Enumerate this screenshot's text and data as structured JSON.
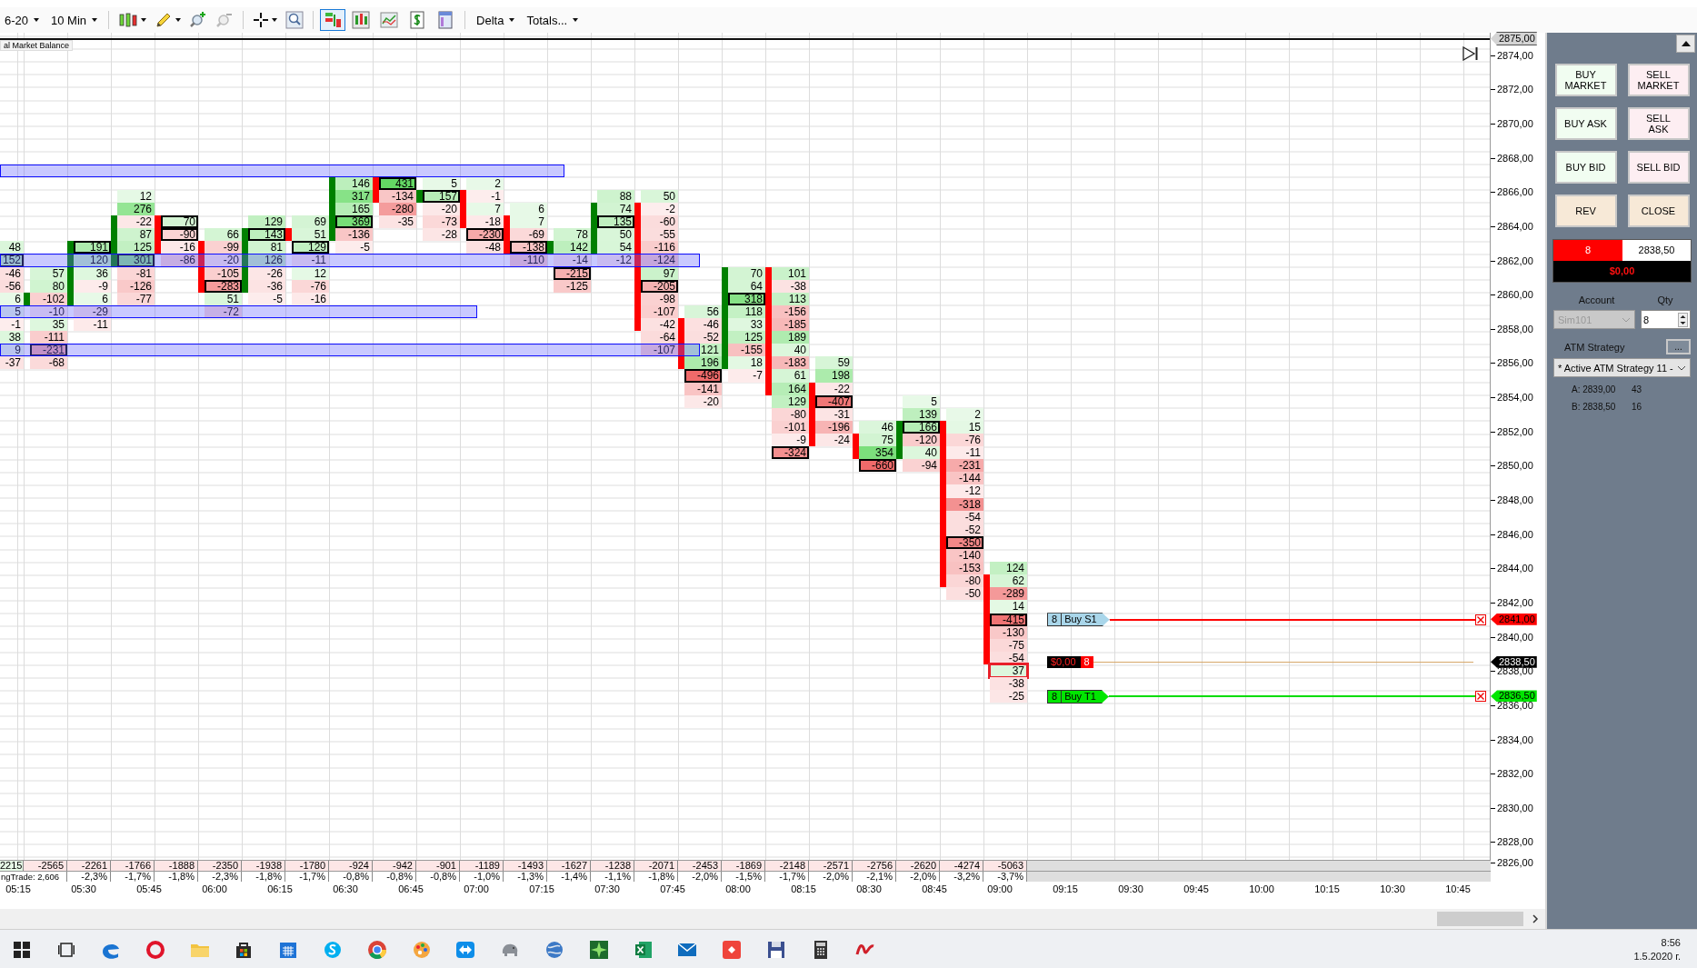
{
  "toolbar": {
    "instrument": "6-20",
    "interval": "10 Min",
    "views": [
      {
        "selected": true
      },
      {
        "selected": false
      },
      {
        "selected": false
      },
      {
        "selected": false
      },
      {
        "selected": false
      }
    ],
    "mode": "Delta",
    "totals": "Totals..."
  },
  "chart": {
    "indicator_label": "al Market Balance",
    "top_price": "2875,00",
    "axis_labels": [
      "2874,00",
      "2872,00",
      "2870,00",
      "2868,00",
      "2866,00",
      "2864,00",
      "2862,00",
      "2860,00",
      "2858,00",
      "2856,00",
      "2854,00",
      "2852,00",
      "2850,00",
      "2848,00",
      "2846,00",
      "2844,00",
      "2842,00",
      "2840,00",
      "2838,00",
      "2836,00",
      "2834,00",
      "2832,00",
      "2830,00",
      "2828,00",
      "2826,00"
    ],
    "footprint": {
      "bars": [
        {
          "cells": [
            null,
            null,
            null,
            null,
            null,
            {
              "value": "48",
              "outlined": false,
              "candle": false,
              "current": false
            },
            {
              "value": "152",
              "outlined": true,
              "candle": false,
              "current": false
            },
            {
              "value": "-46",
              "outlined": false,
              "candle": false,
              "current": false
            },
            {
              "value": "-56",
              "outlined": false,
              "candle": false,
              "current": false
            },
            {
              "value": "6",
              "outlined": false,
              "candle": false,
              "current": false
            },
            {
              "value": "5",
              "outlined": false,
              "candle": false,
              "current": false
            },
            {
              "value": "-1",
              "outlined": false,
              "candle": false,
              "current": false
            },
            {
              "value": "38",
              "outlined": false,
              "candle": false,
              "current": false
            },
            {
              "value": "9",
              "outlined": false,
              "candle": false,
              "current": false
            },
            {
              "value": "-37",
              "outlined": false,
              "candle": false,
              "current": false
            }
          ]
        },
        {
          "color": "#008000",
          "cells": [
            null,
            null,
            null,
            null,
            null,
            null,
            null,
            {
              "value": "57",
              "outlined": false,
              "candle": false,
              "current": false
            },
            {
              "value": "80",
              "outlined": false,
              "candle": false,
              "current": false
            },
            {
              "value": "-102",
              "outlined": false,
              "candle": true,
              "current": false
            },
            {
              "value": "-10",
              "outlined": false,
              "candle": false,
              "current": false
            },
            {
              "value": "35",
              "outlined": false,
              "candle": false,
              "current": false
            },
            {
              "value": "-111",
              "outlined": false,
              "candle": false,
              "current": false
            },
            {
              "value": "-231",
              "outlined": true,
              "candle": false,
              "current": false
            },
            {
              "value": "-68",
              "outlined": false,
              "candle": false,
              "current": false
            }
          ]
        },
        {
          "color": "#008000",
          "cells": [
            null,
            null,
            null,
            null,
            null,
            {
              "value": "191",
              "outlined": true,
              "candle": true,
              "current": false
            },
            {
              "value": "120",
              "outlined": false,
              "candle": true,
              "current": false
            },
            {
              "value": "36",
              "outlined": false,
              "candle": true,
              "current": false
            },
            {
              "value": "-9",
              "outlined": false,
              "candle": true,
              "current": false
            },
            {
              "value": "6",
              "outlined": false,
              "candle": true,
              "current": false
            },
            {
              "value": "-29",
              "outlined": false,
              "candle": false,
              "current": false
            },
            {
              "value": "-11",
              "outlined": false,
              "candle": false,
              "current": false
            }
          ]
        },
        {
          "color": "#008000",
          "cells": [
            null,
            {
              "value": "12",
              "outlined": false,
              "candle": false,
              "current": false
            },
            {
              "value": "276",
              "outlined": false,
              "candle": false,
              "current": false
            },
            {
              "value": "-22",
              "outlined": false,
              "candle": true,
              "current": false
            },
            {
              "value": "87",
              "outlined": false,
              "candle": true,
              "current": false
            },
            {
              "value": "125",
              "outlined": false,
              "candle": true,
              "current": false
            },
            {
              "value": "301",
              "outlined": true,
              "candle": true,
              "current": false
            },
            {
              "value": "-81",
              "outlined": false,
              "candle": false,
              "current": false
            },
            {
              "value": "-126",
              "outlined": false,
              "candle": false,
              "current": false
            },
            {
              "value": "-77",
              "outlined": false,
              "candle": false,
              "current": false
            }
          ]
        },
        {
          "color": "#ff0000",
          "cells": [
            null,
            null,
            null,
            {
              "value": "70",
              "outlined": true,
              "candle": true,
              "current": false
            },
            {
              "value": "-90",
              "outlined": true,
              "candle": true,
              "current": false
            },
            {
              "value": "-16",
              "outlined": false,
              "candle": true,
              "current": false
            },
            {
              "value": "-86",
              "outlined": false,
              "candle": false,
              "current": false
            }
          ]
        },
        {
          "color": "#ff0000",
          "cells": [
            null,
            null,
            null,
            null,
            {
              "value": "66",
              "outlined": false,
              "candle": false,
              "current": false
            },
            {
              "value": "-99",
              "outlined": false,
              "candle": true,
              "current": false
            },
            {
              "value": "-20",
              "outlined": false,
              "candle": true,
              "current": false
            },
            {
              "value": "-105",
              "outlined": false,
              "candle": true,
              "current": false
            },
            {
              "value": "-283",
              "outlined": true,
              "candle": true,
              "current": false
            },
            {
              "value": "51",
              "outlined": false,
              "candle": false,
              "current": false
            },
            {
              "value": "-72",
              "outlined": false,
              "candle": false,
              "current": false
            }
          ]
        },
        {
          "color": "#008000",
          "cells": [
            null,
            null,
            null,
            {
              "value": "129",
              "outlined": false,
              "candle": false,
              "current": false
            },
            {
              "value": "143",
              "outlined": true,
              "candle": true,
              "current": false
            },
            {
              "value": "81",
              "outlined": false,
              "candle": true,
              "current": false
            },
            {
              "value": "126",
              "outlined": false,
              "candle": true,
              "current": false
            },
            {
              "value": "-26",
              "outlined": false,
              "candle": true,
              "current": false
            },
            {
              "value": "-36",
              "outlined": false,
              "candle": true,
              "current": false
            },
            {
              "value": "-5",
              "outlined": false,
              "candle": false,
              "current": false
            }
          ]
        },
        {
          "color": "#ff0000",
          "cells": [
            null,
            null,
            null,
            {
              "value": "69",
              "outlined": false,
              "candle": false,
              "current": false
            },
            {
              "value": "51",
              "outlined": false,
              "candle": true,
              "current": false
            },
            {
              "value": "129",
              "outlined": true,
              "candle": false,
              "current": false
            },
            {
              "value": "-11",
              "outlined": false,
              "candle": false,
              "current": false
            },
            {
              "value": "12",
              "outlined": false,
              "candle": false,
              "current": false
            },
            {
              "value": "-76",
              "outlined": false,
              "candle": false,
              "current": false
            },
            {
              "value": "-16",
              "outlined": false,
              "candle": false,
              "current": false
            }
          ]
        },
        {
          "color": "#008000",
          "cells": [
            {
              "value": "146",
              "outlined": false,
              "candle": true,
              "current": false
            },
            {
              "value": "317",
              "outlined": false,
              "candle": true,
              "current": false
            },
            {
              "value": "165",
              "outlined": false,
              "candle": true,
              "current": false
            },
            {
              "value": "369",
              "outlined": true,
              "candle": true,
              "current": false
            },
            {
              "value": "-136",
              "outlined": false,
              "candle": true,
              "current": false
            },
            {
              "value": "-5",
              "outlined": false,
              "candle": false,
              "current": false
            }
          ]
        },
        {
          "color": "#ff0000",
          "cells": [
            {
              "value": "431",
              "outlined": true,
              "candle": true,
              "current": false
            },
            {
              "value": "-134",
              "outlined": false,
              "candle": true,
              "current": false
            },
            {
              "value": "-280",
              "outlined": false,
              "candle": false,
              "current": false
            },
            {
              "value": "-35",
              "outlined": false,
              "candle": false,
              "current": false
            }
          ]
        },
        {
          "color": "#008000",
          "cells": [
            {
              "value": "5",
              "outlined": false,
              "candle": false,
              "current": false
            },
            {
              "value": "157",
              "outlined": true,
              "candle": true,
              "current": false
            },
            {
              "value": "-20",
              "outlined": false,
              "candle": false,
              "current": false
            },
            {
              "value": "-73",
              "outlined": false,
              "candle": false,
              "current": false
            },
            {
              "value": "-28",
              "outlined": false,
              "candle": false,
              "current": false
            }
          ]
        },
        {
          "color": "#ff0000",
          "cells": [
            {
              "value": "2",
              "outlined": false,
              "candle": false,
              "current": false
            },
            {
              "value": "-1",
              "outlined": false,
              "candle": true,
              "current": false
            },
            {
              "value": "7",
              "outlined": false,
              "candle": true,
              "current": false
            },
            {
              "value": "-18",
              "outlined": false,
              "candle": true,
              "current": false
            },
            {
              "value": "-230",
              "outlined": true,
              "candle": false,
              "current": false
            },
            {
              "value": "-48",
              "outlined": false,
              "candle": false,
              "current": false
            }
          ]
        },
        {
          "color": "#ff0000",
          "cells": [
            null,
            null,
            {
              "value": "6",
              "outlined": false,
              "candle": false,
              "current": false
            },
            {
              "value": "7",
              "outlined": false,
              "candle": true,
              "current": false
            },
            {
              "value": "-69",
              "outlined": false,
              "candle": true,
              "current": false
            },
            {
              "value": "-138",
              "outlined": true,
              "candle": true,
              "current": false
            },
            {
              "value": "-110",
              "outlined": false,
              "candle": false,
              "current": false
            }
          ]
        },
        {
          "color": "#008000",
          "cells": [
            null,
            null,
            null,
            null,
            {
              "value": "78",
              "outlined": false,
              "candle": false,
              "current": false
            },
            {
              "value": "142",
              "outlined": false,
              "candle": true,
              "current": false
            },
            {
              "value": "-14",
              "outlined": false,
              "candle": false,
              "current": false
            },
            {
              "value": "-215",
              "outlined": true,
              "candle": false,
              "current": false
            },
            {
              "value": "-125",
              "outlined": false,
              "candle": false,
              "current": false
            }
          ]
        },
        {
          "color": "#008000",
          "cells": [
            null,
            {
              "value": "88",
              "outlined": false,
              "candle": false,
              "current": false
            },
            {
              "value": "74",
              "outlined": false,
              "candle": true,
              "current": false
            },
            {
              "value": "135",
              "outlined": true,
              "candle": true,
              "current": false
            },
            {
              "value": "50",
              "outlined": false,
              "candle": true,
              "current": false
            },
            {
              "value": "54",
              "outlined": false,
              "candle": true,
              "current": false
            },
            {
              "value": "-12",
              "outlined": false,
              "candle": false,
              "current": false
            }
          ]
        },
        {
          "color": "#ff0000",
          "cells": [
            null,
            {
              "value": "50",
              "outlined": false,
              "candle": false,
              "current": false
            },
            {
              "value": "-2",
              "outlined": false,
              "candle": true,
              "current": false
            },
            {
              "value": "-60",
              "outlined": false,
              "candle": true,
              "current": false
            },
            {
              "value": "-55",
              "outlined": false,
              "candle": true,
              "current": false
            },
            {
              "value": "-116",
              "outlined": false,
              "candle": true,
              "current": false
            },
            {
              "value": "-124",
              "outlined": false,
              "candle": true,
              "current": false
            },
            {
              "value": "97",
              "outlined": false,
              "candle": true,
              "current": false
            },
            {
              "value": "-205",
              "outlined": true,
              "candle": true,
              "current": false
            },
            {
              "value": "-98",
              "outlined": false,
              "candle": true,
              "current": false
            },
            {
              "value": "-107",
              "outlined": false,
              "candle": true,
              "current": false
            },
            {
              "value": "-42",
              "outlined": false,
              "candle": true,
              "current": false
            },
            {
              "value": "-64",
              "outlined": false,
              "candle": false,
              "current": false
            },
            {
              "value": "-107",
              "outlined": false,
              "candle": false,
              "current": false
            }
          ]
        },
        {
          "color": "#ff0000",
          "cells": [
            null,
            null,
            null,
            null,
            null,
            null,
            null,
            null,
            null,
            null,
            {
              "value": "56",
              "outlined": false,
              "candle": false,
              "current": false
            },
            {
              "value": "-46",
              "outlined": false,
              "candle": true,
              "current": false
            },
            {
              "value": "-52",
              "outlined": false,
              "candle": true,
              "current": false
            },
            {
              "value": "121",
              "outlined": false,
              "candle": true,
              "current": false
            },
            {
              "value": "196",
              "outlined": false,
              "candle": true,
              "current": false
            },
            {
              "value": "-496",
              "outlined": true,
              "candle": false,
              "current": false
            },
            {
              "value": "-141",
              "outlined": false,
              "candle": false,
              "current": false
            },
            {
              "value": "-20",
              "outlined": false,
              "candle": false,
              "current": false
            }
          ]
        },
        {
          "color": "#008000",
          "cells": [
            null,
            null,
            null,
            null,
            null,
            null,
            null,
            {
              "value": "70",
              "outlined": false,
              "candle": true,
              "current": false
            },
            {
              "value": "64",
              "outlined": false,
              "candle": true,
              "current": false
            },
            {
              "value": "318",
              "outlined": true,
              "candle": true,
              "current": false
            },
            {
              "value": "118",
              "outlined": false,
              "candle": true,
              "current": false
            },
            {
              "value": "33",
              "outlined": false,
              "candle": true,
              "current": false
            },
            {
              "value": "125",
              "outlined": false,
              "candle": true,
              "current": false
            },
            {
              "value": "-155",
              "outlined": false,
              "candle": true,
              "current": false
            },
            {
              "value": "18",
              "outlined": false,
              "candle": true,
              "current": false
            },
            {
              "value": "-7",
              "outlined": false,
              "candle": false,
              "current": false
            }
          ]
        },
        {
          "color": "#ff0000",
          "cells": [
            null,
            null,
            null,
            null,
            null,
            null,
            null,
            {
              "value": "101",
              "outlined": false,
              "candle": true,
              "current": false
            },
            {
              "value": "-38",
              "outlined": false,
              "candle": true,
              "current": false
            },
            {
              "value": "113",
              "outlined": false,
              "candle": true,
              "current": false
            },
            {
              "value": "-156",
              "outlined": false,
              "candle": true,
              "current": false
            },
            {
              "value": "-185",
              "outlined": false,
              "candle": true,
              "current": false
            },
            {
              "value": "189",
              "outlined": false,
              "candle": true,
              "current": false
            },
            {
              "value": "40",
              "outlined": false,
              "candle": true,
              "current": false
            },
            {
              "value": "-183",
              "outlined": false,
              "candle": true,
              "current": false
            },
            {
              "value": "61",
              "outlined": false,
              "candle": true,
              "current": false
            },
            {
              "value": "164",
              "outlined": false,
              "candle": true,
              "current": false
            },
            {
              "value": "129",
              "outlined": false,
              "candle": false,
              "current": false
            },
            {
              "value": "-80",
              "outlined": false,
              "candle": false,
              "current": false
            },
            {
              "value": "-101",
              "outlined": false,
              "candle": false,
              "current": false
            },
            {
              "value": "-9",
              "outlined": false,
              "candle": false,
              "current": false
            },
            {
              "value": "-324",
              "outlined": true,
              "candle": false,
              "current": false
            }
          ]
        },
        {
          "color": "#ff0000",
          "cells": [
            null,
            null,
            null,
            null,
            null,
            null,
            null,
            null,
            null,
            null,
            null,
            null,
            null,
            null,
            {
              "value": "59",
              "outlined": false,
              "candle": false,
              "current": false
            },
            {
              "value": "198",
              "outlined": false,
              "candle": false,
              "current": false
            },
            {
              "value": "-22",
              "outlined": false,
              "candle": true,
              "current": false
            },
            {
              "value": "-407",
              "outlined": true,
              "candle": true,
              "current": false
            },
            {
              "value": "-31",
              "outlined": false,
              "candle": true,
              "current": false
            },
            {
              "value": "-196",
              "outlined": false,
              "candle": true,
              "current": false
            },
            {
              "value": "-24",
              "outlined": false,
              "candle": true,
              "current": false
            }
          ]
        },
        {
          "color": "#ff0000",
          "cells": [
            null,
            null,
            null,
            null,
            null,
            null,
            null,
            null,
            null,
            null,
            null,
            null,
            null,
            null,
            null,
            null,
            null,
            null,
            null,
            {
              "value": "46",
              "outlined": false,
              "candle": false,
              "current": false
            },
            {
              "value": "75",
              "outlined": false,
              "candle": true,
              "current": false
            },
            {
              "value": "354",
              "outlined": false,
              "candle": true,
              "current": false
            },
            {
              "value": "-660",
              "outlined": true,
              "candle": false,
              "current": false
            }
          ]
        },
        {
          "color": "#008000",
          "cells": [
            null,
            null,
            null,
            null,
            null,
            null,
            null,
            null,
            null,
            null,
            null,
            null,
            null,
            null,
            null,
            null,
            null,
            {
              "value": "5",
              "outlined": false,
              "candle": false,
              "current": false
            },
            {
              "value": "139",
              "outlined": false,
              "candle": false,
              "current": false
            },
            {
              "value": "166",
              "outlined": true,
              "candle": true,
              "current": false
            },
            {
              "value": "-120",
              "outlined": false,
              "candle": true,
              "current": false
            },
            {
              "value": "40",
              "outlined": false,
              "candle": true,
              "current": false
            },
            {
              "value": "-94",
              "outlined": false,
              "candle": false,
              "current": false
            }
          ]
        },
        {
          "color": "#ff0000",
          "cells": [
            null,
            null,
            null,
            null,
            null,
            null,
            null,
            null,
            null,
            null,
            null,
            null,
            null,
            null,
            null,
            null,
            null,
            null,
            {
              "value": "2",
              "outlined": false,
              "candle": false,
              "current": false
            },
            {
              "value": "15",
              "outlined": false,
              "candle": true,
              "current": false
            },
            {
              "value": "-76",
              "outlined": false,
              "candle": true,
              "current": false
            },
            {
              "value": "-11",
              "outlined": false,
              "candle": true,
              "current": false
            },
            {
              "value": "-231",
              "outlined": false,
              "candle": true,
              "current": false
            },
            {
              "value": "-144",
              "outlined": false,
              "candle": true,
              "current": false
            },
            {
              "value": "-12",
              "outlined": false,
              "candle": true,
              "current": false
            },
            {
              "value": "-318",
              "outlined": false,
              "candle": true,
              "current": false
            },
            {
              "value": "-54",
              "outlined": false,
              "candle": true,
              "current": false
            },
            {
              "value": "-52",
              "outlined": false,
              "candle": true,
              "current": false
            },
            {
              "value": "-350",
              "outlined": true,
              "candle": true,
              "current": false
            },
            {
              "value": "-140",
              "outlined": false,
              "candle": true,
              "current": false
            },
            {
              "value": "-153",
              "outlined": false,
              "candle": true,
              "current": false
            },
            {
              "value": "-80",
              "outlined": false,
              "candle": true,
              "current": false
            },
            {
              "value": "-50",
              "outlined": false,
              "candle": false,
              "current": false
            }
          ]
        },
        {
          "color": "#ff0000",
          "cells": [
            null,
            null,
            null,
            null,
            null,
            null,
            null,
            null,
            null,
            null,
            null,
            null,
            null,
            null,
            null,
            null,
            null,
            null,
            null,
            null,
            null,
            null,
            null,
            null,
            null,
            null,
            null,
            null,
            null,
            null,
            {
              "value": "124",
              "outlined": false,
              "candle": false,
              "current": false
            },
            {
              "value": "62",
              "outlined": false,
              "candle": true,
              "current": false
            },
            {
              "value": "-289",
              "outlined": false,
              "candle": true,
              "current": false
            },
            {
              "value": "14",
              "outlined": false,
              "candle": true,
              "current": false
            },
            {
              "value": "-415",
              "outlined": true,
              "candle": true,
              "current": false
            },
            {
              "value": "-130",
              "outlined": false,
              "candle": true,
              "current": false
            },
            {
              "value": "-75",
              "outlined": false,
              "candle": true,
              "current": false
            },
            {
              "value": "-54",
              "outlined": false,
              "candle": true,
              "current": false
            },
            {
              "value": "37",
              "outlined": false,
              "candle": false,
              "current": true
            },
            {
              "value": "-38",
              "outlined": false,
              "candle": false,
              "current": false
            },
            {
              "value": "-25",
              "outlined": false,
              "candle": false,
              "current": false
            }
          ]
        }
      ]
    },
    "orders": [
      {
        "kind": "stop",
        "qty": "8",
        "label": "Buy S1",
        "price_tag": "2841,00"
      },
      {
        "kind": "target",
        "qty": "8",
        "label": "Buy T1",
        "price_tag": "2836,50"
      }
    ],
    "position": {
      "pnl": "$0,00",
      "qty": "8",
      "price_tag": "2838,50"
    },
    "totals": {
      "delta": [
        "2215",
        "-2565",
        "-2261",
        "-1766",
        "-1888",
        "-2350",
        "-1938",
        "-1780",
        "-924",
        "-942",
        "-901",
        "-1189",
        "-1493",
        "-1627",
        "-1238",
        "-2071",
        "-2453",
        "-1869",
        "-2148",
        "-2571",
        "-2756",
        "-2620",
        "-4274",
        "-5063"
      ],
      "label": "ngTrade: 2,606",
      "percent": [
        "-2,3%",
        "-1,7%",
        "-1,8%",
        "-2,3%",
        "-1,8%",
        "-1,7%",
        "-0,8%",
        "-0,8%",
        "-0,8%",
        "-1,0%",
        "-1,3%",
        "-1,4%",
        "-1,1%",
        "-1,8%",
        "-2,0%",
        "-1,5%",
        "-1,7%",
        "-2,0%",
        "-2,1%",
        "-2,0%",
        "-3,2%",
        "-3,7%"
      ]
    },
    "time_labels": [
      "05:15",
      "05:30",
      "05:45",
      "06:00",
      "06:15",
      "06:30",
      "06:45",
      "07:00",
      "07:15",
      "07:30",
      "07:45",
      "08:00",
      "08:15",
      "08:30",
      "08:45",
      "09:00",
      "09:15",
      "09:30",
      "09:45",
      "10:00",
      "10:15",
      "10:30",
      "10:45"
    ]
  },
  "panel": {
    "buttons": [
      {
        "label": "BUY MARKET",
        "kind": "buy"
      },
      {
        "label": "SELL MARKET",
        "kind": "sell"
      },
      {
        "label": "BUY ASK",
        "kind": "buy"
      },
      {
        "label": "SELL ASK",
        "kind": "sell"
      },
      {
        "label": "BUY BID",
        "kind": "buy"
      },
      {
        "label": "SELL BID",
        "kind": "sell"
      },
      {
        "label": "REV",
        "kind": "neutral"
      },
      {
        "label": "CLOSE",
        "kind": "neutral"
      }
    ],
    "position_qty": "8",
    "position_price": "2838,50",
    "pnl": "$0,00",
    "account_label": "Account",
    "qty_label": "Qty",
    "account": {
      "value": "Sim101",
      "disabled": true
    },
    "qty": "8",
    "atm_label": "ATM Strategy",
    "atm_button": "...",
    "atm_strategy": "* Active ATM Strategy 11 -",
    "quotes": [
      {
        "label": "A: 2839,00",
        "size": "43"
      },
      {
        "label": "B: 2838,50",
        "size": "16"
      }
    ]
  },
  "taskbar": {
    "time": "8:56",
    "date": "1.5.2020 г."
  }
}
